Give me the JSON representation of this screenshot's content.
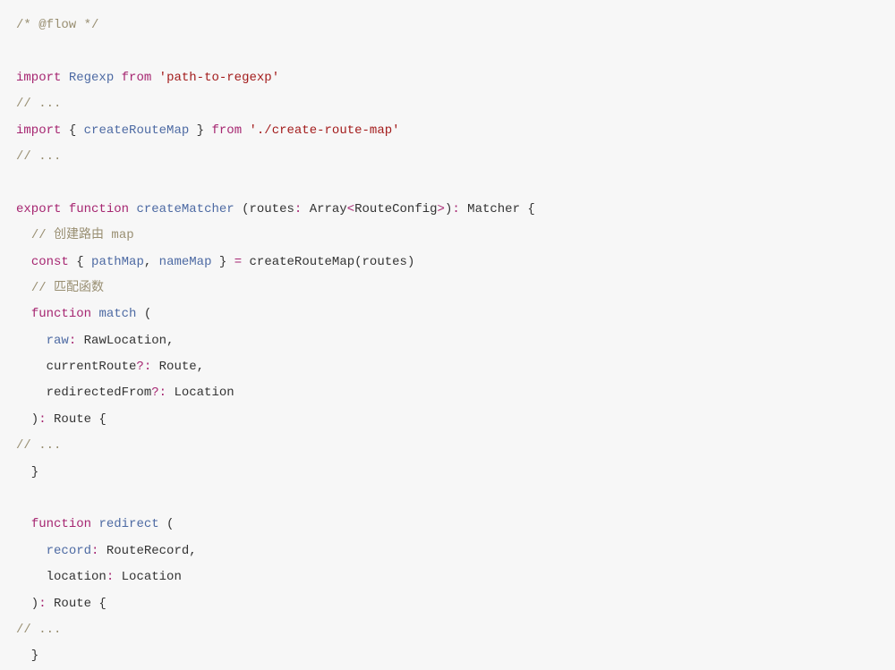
{
  "code": {
    "tokens": [
      [
        {
          "t": "/* @flow */",
          "c": "comment"
        }
      ],
      [],
      [
        {
          "t": "import",
          "c": "keyword"
        },
        {
          "t": " "
        },
        {
          "t": "Regexp",
          "c": "class-name"
        },
        {
          "t": " "
        },
        {
          "t": "from",
          "c": "keyword"
        },
        {
          "t": " "
        },
        {
          "t": "'path-to-regexp'",
          "c": "string"
        }
      ],
      [
        {
          "t": "// ...",
          "c": "comment"
        }
      ],
      [
        {
          "t": "import",
          "c": "keyword"
        },
        {
          "t": " { "
        },
        {
          "t": "createRouteMap",
          "c": "var"
        },
        {
          "t": " } "
        },
        {
          "t": "from",
          "c": "keyword"
        },
        {
          "t": " "
        },
        {
          "t": "'./create-route-map'",
          "c": "string"
        }
      ],
      [
        {
          "t": "// ...",
          "c": "comment"
        }
      ],
      [],
      [
        {
          "t": "export",
          "c": "keyword"
        },
        {
          "t": " "
        },
        {
          "t": "function",
          "c": "keyword"
        },
        {
          "t": " "
        },
        {
          "t": "createMatcher",
          "c": "fn-name"
        },
        {
          "t": " (routes"
        },
        {
          "t": ":",
          "c": "operator"
        },
        {
          "t": " Array"
        },
        {
          "t": "<",
          "c": "operator"
        },
        {
          "t": "RouteConfig"
        },
        {
          "t": ">",
          "c": "operator"
        },
        {
          "t": ")"
        },
        {
          "t": ":",
          "c": "operator"
        },
        {
          "t": " Matcher {"
        }
      ],
      [
        {
          "t": "  "
        },
        {
          "t": "// 创建路由 map",
          "c": "comment"
        }
      ],
      [
        {
          "t": "  "
        },
        {
          "t": "const",
          "c": "keyword"
        },
        {
          "t": " { "
        },
        {
          "t": "pathMap",
          "c": "var"
        },
        {
          "t": ", "
        },
        {
          "t": "nameMap",
          "c": "var"
        },
        {
          "t": " } "
        },
        {
          "t": "=",
          "c": "operator"
        },
        {
          "t": " createRouteMap(routes)"
        }
      ],
      [
        {
          "t": "  "
        },
        {
          "t": "// 匹配函数",
          "c": "comment"
        }
      ],
      [
        {
          "t": "  "
        },
        {
          "t": "function",
          "c": "keyword"
        },
        {
          "t": " "
        },
        {
          "t": "match",
          "c": "fn-name"
        },
        {
          "t": " ("
        }
      ],
      [
        {
          "t": "    "
        },
        {
          "t": "raw",
          "c": "param"
        },
        {
          "t": ":",
          "c": "operator"
        },
        {
          "t": " RawLocation,"
        }
      ],
      [
        {
          "t": "    currentRoute"
        },
        {
          "t": "?",
          "c": "maybe"
        },
        {
          "t": ":",
          "c": "operator"
        },
        {
          "t": " Route,"
        }
      ],
      [
        {
          "t": "    redirectedFrom"
        },
        {
          "t": "?",
          "c": "maybe"
        },
        {
          "t": ":",
          "c": "operator"
        },
        {
          "t": " Location"
        }
      ],
      [
        {
          "t": "  )"
        },
        {
          "t": ":",
          "c": "operator"
        },
        {
          "t": " Route {"
        }
      ],
      [
        {
          "t": "// ...",
          "c": "comment"
        }
      ],
      [
        {
          "t": "  }"
        }
      ],
      [],
      [
        {
          "t": "  "
        },
        {
          "t": "function",
          "c": "keyword"
        },
        {
          "t": " "
        },
        {
          "t": "redirect",
          "c": "fn-name"
        },
        {
          "t": " ("
        }
      ],
      [
        {
          "t": "    "
        },
        {
          "t": "record",
          "c": "param"
        },
        {
          "t": ":",
          "c": "operator"
        },
        {
          "t": " RouteRecord,"
        }
      ],
      [
        {
          "t": "    location"
        },
        {
          "t": ":",
          "c": "operator"
        },
        {
          "t": " Location"
        }
      ],
      [
        {
          "t": "  )"
        },
        {
          "t": ":",
          "c": "operator"
        },
        {
          "t": " Route {"
        }
      ],
      [
        {
          "t": "// ...",
          "c": "comment"
        }
      ],
      [
        {
          "t": "  }"
        }
      ]
    ]
  }
}
